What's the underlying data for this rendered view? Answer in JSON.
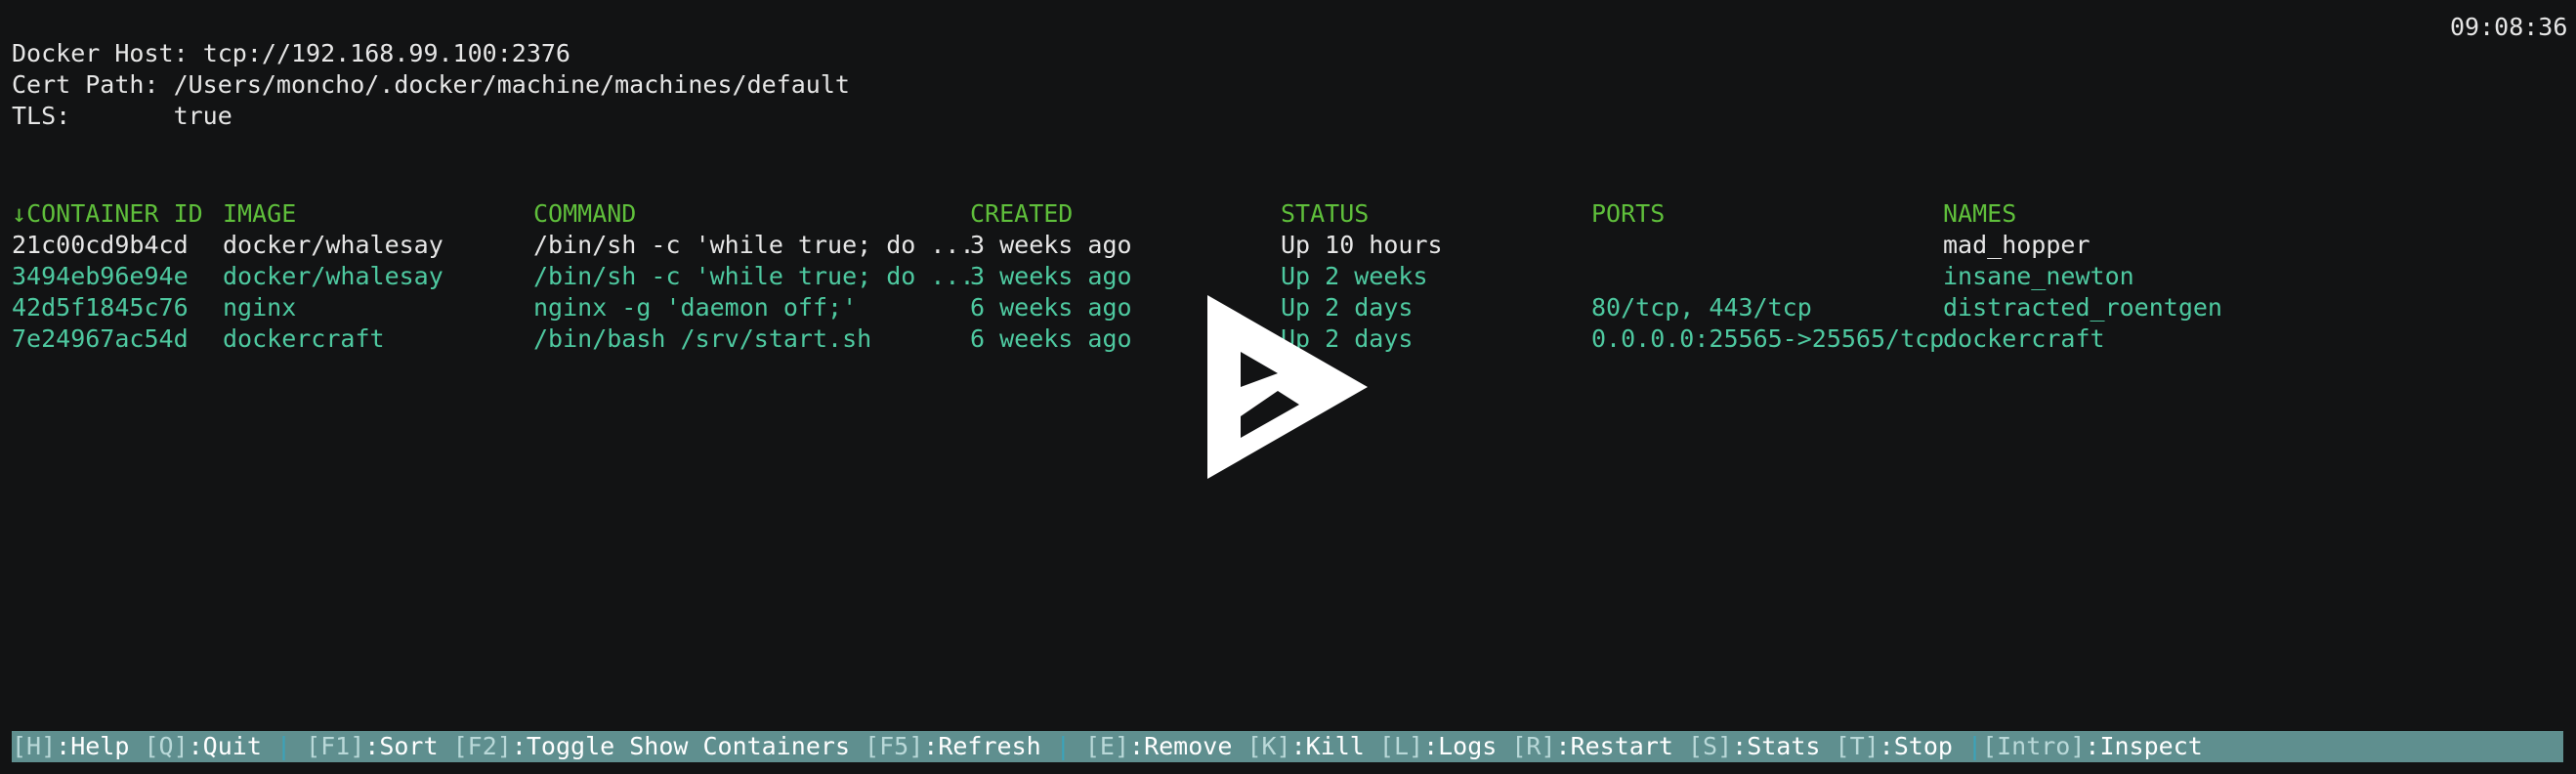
{
  "clock": "09:08:36",
  "info": {
    "host_label": "Docker Host:",
    "host_value": "tcp://192.168.99.100:2376",
    "cert_label": "Cert Path:",
    "cert_value": "/Users/moncho/.docker/machine/machines/default",
    "tls_label": "TLS:",
    "tls_value": "true"
  },
  "table": {
    "sort_indicator": "↓",
    "headers": {
      "id": "CONTAINER ID",
      "image": "IMAGE",
      "command": "COMMAND",
      "created": "CREATED",
      "status": "STATUS",
      "ports": "PORTS",
      "names": "NAMES"
    },
    "rows": [
      {
        "id": "21c00cd9b4cd",
        "image": "docker/whalesay",
        "command": "/bin/sh -c 'while true; do ...",
        "created": "3 weeks ago",
        "status": "Up 10 hours",
        "ports": "",
        "names": "mad_hopper"
      },
      {
        "id": "3494eb96e94e",
        "image": "docker/whalesay",
        "command": "/bin/sh -c 'while true; do ...",
        "created": "3 weeks ago",
        "status": "Up 2 weeks",
        "ports": "",
        "names": "insane_newton"
      },
      {
        "id": "42d5f1845c76",
        "image": "nginx",
        "command": "nginx -g 'daemon off;'",
        "created": "6 weeks ago",
        "status": "Up 2 days",
        "ports": "80/tcp, 443/tcp",
        "names": "distracted_roentgen"
      },
      {
        "id": "7e24967ac54d",
        "image": "dockercraft",
        "command": "/bin/bash /srv/start.sh",
        "created": "6 weeks ago",
        "status": "Up 2 days",
        "ports": "0.0.0.0:25565->25565/tcp",
        "names": "dockercraft"
      }
    ]
  },
  "statusbar": {
    "help_key": "[H]",
    "help_label": ":Help ",
    "quit_key": "[Q]",
    "quit_label": ":Quit ",
    "sep": "|",
    "sort_key": "[F1]",
    "sort_label": ":Sort ",
    "toggle_key": "[F2]",
    "toggle_label": ":Toggle Show Containers ",
    "refresh_key": "[F5]",
    "refresh_label": ":Refresh ",
    "remove_key": "[E]",
    "remove_label": ":Remove ",
    "kill_key": "[K]",
    "kill_label": ":Kill ",
    "logs_key": "[L]",
    "logs_label": ":Logs ",
    "restart_key": "[R]",
    "restart_label": ":Restart ",
    "stats_key": "[S]",
    "stats_label": ":Stats ",
    "stop_key": "[T]",
    "stop_label": ":Stop ",
    "inspect_key": "[Intro]",
    "inspect_label": ":Inspect"
  },
  "overlay": {
    "icon": "asciinema-play-icon",
    "color": "#ffffff"
  },
  "colors": {
    "background": "#121314",
    "header": "#5fbf3b",
    "row_highlight": "#4ec9a0",
    "statusbar_bg": "#5f8f8f"
  }
}
